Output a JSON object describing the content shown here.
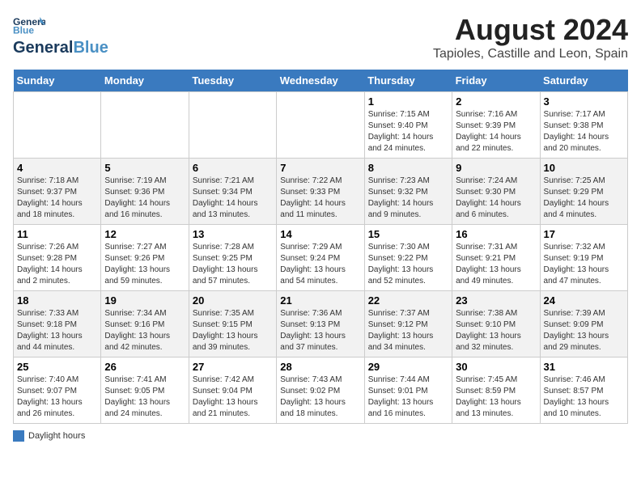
{
  "header": {
    "logo_line1": "General",
    "logo_line2": "Blue",
    "main_title": "August 2024",
    "subtitle": "Tapioles, Castille and Leon, Spain"
  },
  "weekdays": [
    "Sunday",
    "Monday",
    "Tuesday",
    "Wednesday",
    "Thursday",
    "Friday",
    "Saturday"
  ],
  "weeks": [
    [
      {
        "day": "",
        "detail": ""
      },
      {
        "day": "",
        "detail": ""
      },
      {
        "day": "",
        "detail": ""
      },
      {
        "day": "",
        "detail": ""
      },
      {
        "day": "1",
        "detail": "Sunrise: 7:15 AM\nSunset: 9:40 PM\nDaylight: 14 hours and 24 minutes."
      },
      {
        "day": "2",
        "detail": "Sunrise: 7:16 AM\nSunset: 9:39 PM\nDaylight: 14 hours and 22 minutes."
      },
      {
        "day": "3",
        "detail": "Sunrise: 7:17 AM\nSunset: 9:38 PM\nDaylight: 14 hours and 20 minutes."
      }
    ],
    [
      {
        "day": "4",
        "detail": "Sunrise: 7:18 AM\nSunset: 9:37 PM\nDaylight: 14 hours and 18 minutes."
      },
      {
        "day": "5",
        "detail": "Sunrise: 7:19 AM\nSunset: 9:36 PM\nDaylight: 14 hours and 16 minutes."
      },
      {
        "day": "6",
        "detail": "Sunrise: 7:21 AM\nSunset: 9:34 PM\nDaylight: 14 hours and 13 minutes."
      },
      {
        "day": "7",
        "detail": "Sunrise: 7:22 AM\nSunset: 9:33 PM\nDaylight: 14 hours and 11 minutes."
      },
      {
        "day": "8",
        "detail": "Sunrise: 7:23 AM\nSunset: 9:32 PM\nDaylight: 14 hours and 9 minutes."
      },
      {
        "day": "9",
        "detail": "Sunrise: 7:24 AM\nSunset: 9:30 PM\nDaylight: 14 hours and 6 minutes."
      },
      {
        "day": "10",
        "detail": "Sunrise: 7:25 AM\nSunset: 9:29 PM\nDaylight: 14 hours and 4 minutes."
      }
    ],
    [
      {
        "day": "11",
        "detail": "Sunrise: 7:26 AM\nSunset: 9:28 PM\nDaylight: 14 hours and 2 minutes."
      },
      {
        "day": "12",
        "detail": "Sunrise: 7:27 AM\nSunset: 9:26 PM\nDaylight: 13 hours and 59 minutes."
      },
      {
        "day": "13",
        "detail": "Sunrise: 7:28 AM\nSunset: 9:25 PM\nDaylight: 13 hours and 57 minutes."
      },
      {
        "day": "14",
        "detail": "Sunrise: 7:29 AM\nSunset: 9:24 PM\nDaylight: 13 hours and 54 minutes."
      },
      {
        "day": "15",
        "detail": "Sunrise: 7:30 AM\nSunset: 9:22 PM\nDaylight: 13 hours and 52 minutes."
      },
      {
        "day": "16",
        "detail": "Sunrise: 7:31 AM\nSunset: 9:21 PM\nDaylight: 13 hours and 49 minutes."
      },
      {
        "day": "17",
        "detail": "Sunrise: 7:32 AM\nSunset: 9:19 PM\nDaylight: 13 hours and 47 minutes."
      }
    ],
    [
      {
        "day": "18",
        "detail": "Sunrise: 7:33 AM\nSunset: 9:18 PM\nDaylight: 13 hours and 44 minutes."
      },
      {
        "day": "19",
        "detail": "Sunrise: 7:34 AM\nSunset: 9:16 PM\nDaylight: 13 hours and 42 minutes."
      },
      {
        "day": "20",
        "detail": "Sunrise: 7:35 AM\nSunset: 9:15 PM\nDaylight: 13 hours and 39 minutes."
      },
      {
        "day": "21",
        "detail": "Sunrise: 7:36 AM\nSunset: 9:13 PM\nDaylight: 13 hours and 37 minutes."
      },
      {
        "day": "22",
        "detail": "Sunrise: 7:37 AM\nSunset: 9:12 PM\nDaylight: 13 hours and 34 minutes."
      },
      {
        "day": "23",
        "detail": "Sunrise: 7:38 AM\nSunset: 9:10 PM\nDaylight: 13 hours and 32 minutes."
      },
      {
        "day": "24",
        "detail": "Sunrise: 7:39 AM\nSunset: 9:09 PM\nDaylight: 13 hours and 29 minutes."
      }
    ],
    [
      {
        "day": "25",
        "detail": "Sunrise: 7:40 AM\nSunset: 9:07 PM\nDaylight: 13 hours and 26 minutes."
      },
      {
        "day": "26",
        "detail": "Sunrise: 7:41 AM\nSunset: 9:05 PM\nDaylight: 13 hours and 24 minutes."
      },
      {
        "day": "27",
        "detail": "Sunrise: 7:42 AM\nSunset: 9:04 PM\nDaylight: 13 hours and 21 minutes."
      },
      {
        "day": "28",
        "detail": "Sunrise: 7:43 AM\nSunset: 9:02 PM\nDaylight: 13 hours and 18 minutes."
      },
      {
        "day": "29",
        "detail": "Sunrise: 7:44 AM\nSunset: 9:01 PM\nDaylight: 13 hours and 16 minutes."
      },
      {
        "day": "30",
        "detail": "Sunrise: 7:45 AM\nSunset: 8:59 PM\nDaylight: 13 hours and 13 minutes."
      },
      {
        "day": "31",
        "detail": "Sunrise: 7:46 AM\nSunset: 8:57 PM\nDaylight: 13 hours and 10 minutes."
      }
    ]
  ],
  "footer": {
    "legend_label": "Daylight hours"
  }
}
